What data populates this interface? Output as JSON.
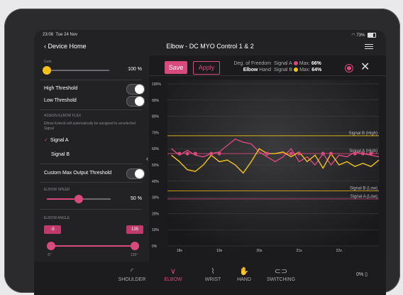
{
  "status": {
    "time": "23:08",
    "date": "Tue 24 Nov",
    "battery": "73%"
  },
  "nav": {
    "back": "Device Home",
    "title": "Elbow - DC MYO Control 1 & 2"
  },
  "left": {
    "gain_label": "Gain",
    "gain_value": "100 %",
    "gain_level": 1.0,
    "high_threshold": "High Threshold",
    "low_threshold": "Low Threshold",
    "assign_header": "ASSIGN ELBOW FLEX",
    "assign_note": "Elbow Extend will automatically be assigned to unselected Signal",
    "signal_a": "Signal A",
    "signal_b": "Signal B",
    "custom_max": "Custom Max Output Threshold",
    "speed_header": "ELBOW SPEED",
    "speed_value": "50 %",
    "speed_level": 0.5,
    "angle_header": "ELBOW ANGLE",
    "angle_min_tag": "-5",
    "angle_max_tag": "135",
    "angle_min_label": "-5°",
    "angle_max_label": "135°"
  },
  "toolbar": {
    "save": "Save",
    "apply": "Apply",
    "dof_label": "Deg. of Freedom",
    "dof_value": "Elbow",
    "dof_value2": "Hand",
    "sig_a": "Signal A",
    "sig_a_max_label": "Max:",
    "sig_a_max": "66%",
    "sig_b": "Signal B",
    "sig_b_max_label": "Max:",
    "sig_b_max": "64%"
  },
  "colors": {
    "signal_a": "#d94a7c",
    "signal_b": "#f2c21a",
    "accent": "#e0457b"
  },
  "tabs": [
    {
      "label": "SHOULDER",
      "icon": "shoulder-icon"
    },
    {
      "label": "ELBOW",
      "icon": "elbow-icon"
    },
    {
      "label": "WRIST",
      "icon": "wrist-icon"
    },
    {
      "label": "HAND",
      "icon": "hand-icon"
    },
    {
      "label": "SWITCHING",
      "icon": "switch-icon"
    }
  ],
  "tab_right": "0%",
  "chart_data": {
    "type": "line",
    "x": [
      17.8,
      18.0,
      18.2,
      18.4,
      18.6,
      18.8,
      19.0,
      19.2,
      19.4,
      19.6,
      19.8,
      20.0,
      20.2,
      20.4,
      20.6,
      20.8,
      21.0,
      21.2,
      21.4,
      21.6,
      21.8,
      22.0,
      22.2,
      22.4,
      22.6,
      22.8,
      23.0
    ],
    "xticks": [
      "18s",
      "19s",
      "20s",
      "21s",
      "22s"
    ],
    "xtick_values": [
      18,
      19,
      20,
      21,
      22
    ],
    "yticks": [
      "0%",
      "10%",
      "20%",
      "30%",
      "40%",
      "50%",
      "60%",
      "70%",
      "80%",
      "90%",
      "100%"
    ],
    "ylim": [
      0,
      100
    ],
    "xlim": [
      17.7,
      23.0
    ],
    "series": [
      {
        "name": "Signal A",
        "color": "#d94a7c",
        "values": [
          60,
          56,
          59,
          56,
          55,
          57,
          58,
          62,
          66,
          64,
          63,
          58,
          55,
          52,
          55,
          60,
          52,
          55,
          50,
          57,
          50,
          56,
          55,
          58,
          57,
          56,
          55
        ]
      },
      {
        "name": "Signal B",
        "color": "#f2c21a",
        "values": [
          56,
          52,
          47,
          46,
          50,
          56,
          52,
          53,
          50,
          45,
          52,
          60,
          57,
          57,
          58,
          55,
          58,
          52,
          56,
          48,
          57,
          50,
          52,
          49,
          51,
          49,
          53
        ]
      }
    ],
    "thresholds": [
      {
        "label": "Signal B (High)",
        "value": 68,
        "color": "#f2c21a"
      },
      {
        "label": "Signal A (High)",
        "value": 57,
        "color": "#d94a7c"
      },
      {
        "label": "Signal B (Low)",
        "value": 34,
        "color": "#f2c21a"
      },
      {
        "label": "Signal A (Low)",
        "value": 29,
        "color": "#d94a7c"
      }
    ]
  }
}
